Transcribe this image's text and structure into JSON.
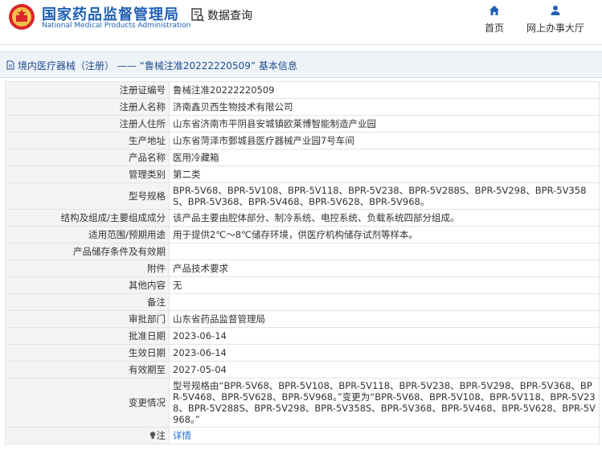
{
  "header": {
    "brand_cn": "国家药品监督管理局",
    "brand_en": "National Medical Products Administration",
    "query_label": "数据查询",
    "nav_home": "首页",
    "nav_service": "网上办事大厅"
  },
  "breadcrumb": "境内医疗器械（注册） —— “鲁械注准20222220509” 基本信息",
  "rows": [
    {
      "label": "注册证编号",
      "value": "鲁械注准20222220509"
    },
    {
      "label": "注册人名称",
      "value": "济南鑫贝西生物技术有限公司"
    },
    {
      "label": "注册人住所",
      "value": "山东省济南市平阴县安城镇欧莱博智能制造产业园"
    },
    {
      "label": "生产地址",
      "value": "山东省菏泽市鄄城县医疗器械产业园7号车间"
    },
    {
      "label": "产品名称",
      "value": "医用冷藏箱"
    },
    {
      "label": "管理类别",
      "value": "第二类"
    },
    {
      "label": "型号规格",
      "value": "BPR-5V68、BPR-5V108、BPR-5V118、BPR-5V238、BPR-5V288S、BPR-5V298、BPR-5V358S、BPR-5V368、BPR-5V468、BPR-5V628、BPR-5V968。"
    },
    {
      "label": "结构及组成/主要组成成分",
      "value": "该产品主要由腔体部分、制冷系统、电控系统、负载系统四部分组成。"
    },
    {
      "label": "适用范围/预期用途",
      "value": "用于提供2℃～8℃储存环境，供医疗机构储存试剂等样本。"
    },
    {
      "label": "产品储存条件及有效期",
      "value": ""
    },
    {
      "label": "附件",
      "value": "产品技术要求"
    },
    {
      "label": "其他内容",
      "value": "无"
    },
    {
      "label": "备注",
      "value": ""
    },
    {
      "label": "审批部门",
      "value": "山东省药品监督管理局"
    },
    {
      "label": "批准日期",
      "value": "2023-06-14"
    },
    {
      "label": "生效日期",
      "value": "2023-06-14"
    },
    {
      "label": "有效期至",
      "value": "2027-05-04"
    },
    {
      "label": "变更情况",
      "value": "型号规格由“BPR-5V68、BPR-5V108、BPR-5V118、BPR-5V238、BPR-5V298、BPR-5V368、BPR-5V468、BPR-5V628、BPR-5V968。”变更为“BPR-5V68、BPR-5V108、BPR-5V118、BPR-5V238、BPR-5V288S、BPR-5V298、BPR-5V358S、BPR-5V368、BPR-5V468、BPR-5V628、BPR-5V968。”"
    }
  ],
  "note_label": "注",
  "note_link": "详情",
  "icons": {
    "logo": "emblem-icon",
    "query": "document-search-icon",
    "home": "home-icon",
    "service": "user-icon",
    "breadcrumb": "document-icon",
    "note": "lightbulb-icon"
  },
  "colors": {
    "brand": "#1f5fb3",
    "link": "#1e6bd6",
    "title_bar": "#eef3f8"
  }
}
